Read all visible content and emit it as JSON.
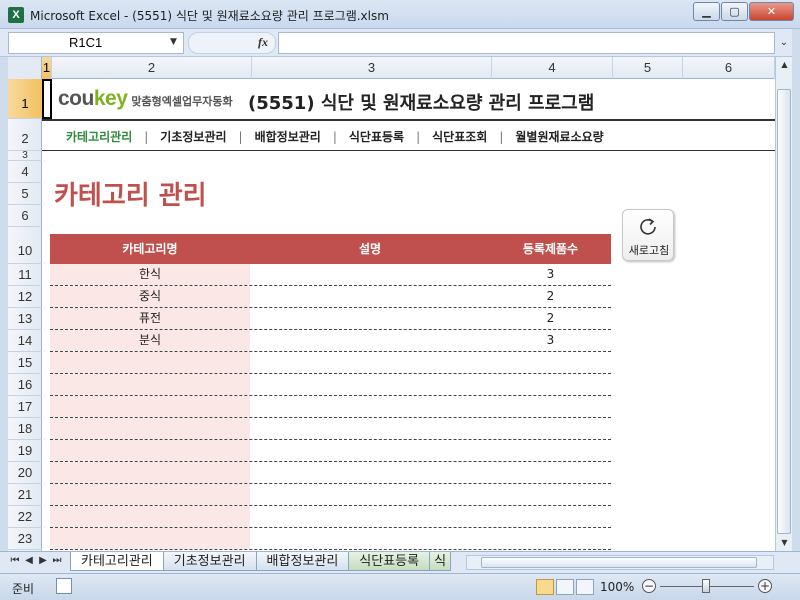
{
  "window": {
    "title": "Microsoft Excel - (5551) 식단 및 원재료소요량 관리 프로그램.xlsm",
    "app_icon": "X",
    "minimize": "▁",
    "maximize": "▢",
    "close": "✕"
  },
  "formula_bar": {
    "name_box": "R1C1",
    "fx": "fx",
    "formula": ""
  },
  "columns": [
    "1",
    "2",
    "3",
    "4",
    "5",
    "6"
  ],
  "rows": [
    "1",
    "2",
    "3",
    "4",
    "5",
    "6",
    "10",
    "11",
    "12",
    "13",
    "14",
    "15",
    "16",
    "17",
    "18",
    "19",
    "20",
    "21",
    "22",
    "23"
  ],
  "brand": {
    "logo_a": "cou",
    "logo_b": "key",
    "subtitle": "맞춤형엑셀업무자동화"
  },
  "app_title": "(5551) 식단 및 원재료소요량 관리 프로그램",
  "nav": [
    "카테고리관리",
    "기초정보관리",
    "배합정보관리",
    "식단표등록",
    "식단표조회",
    "월별원재료소요량"
  ],
  "page_title": "카테고리 관리",
  "refresh_button": "새로고침",
  "table": {
    "headers": [
      "카테고리명",
      "설명",
      "등록제품수"
    ],
    "rows": [
      {
        "name": "한식",
        "desc": "",
        "count": "3"
      },
      {
        "name": "중식",
        "desc": "",
        "count": "2"
      },
      {
        "name": "퓨전",
        "desc": "",
        "count": "2"
      },
      {
        "name": "분식",
        "desc": "",
        "count": "3"
      },
      {
        "name": "",
        "desc": "",
        "count": ""
      },
      {
        "name": "",
        "desc": "",
        "count": ""
      },
      {
        "name": "",
        "desc": "",
        "count": ""
      },
      {
        "name": "",
        "desc": "",
        "count": ""
      },
      {
        "name": "",
        "desc": "",
        "count": ""
      },
      {
        "name": "",
        "desc": "",
        "count": ""
      },
      {
        "name": "",
        "desc": "",
        "count": ""
      },
      {
        "name": "",
        "desc": "",
        "count": ""
      },
      {
        "name": "",
        "desc": "",
        "count": ""
      }
    ]
  },
  "sheet_tabs": [
    "카테고리관리",
    "기초정보관리",
    "배합정보관리",
    "식단표등록",
    "식"
  ],
  "tab_nav": [
    "⏮",
    "◀",
    "▶",
    "⏭"
  ],
  "status": {
    "ready": "준비",
    "zoom": "100%",
    "zoom_minus": "−",
    "zoom_plus": "+"
  }
}
